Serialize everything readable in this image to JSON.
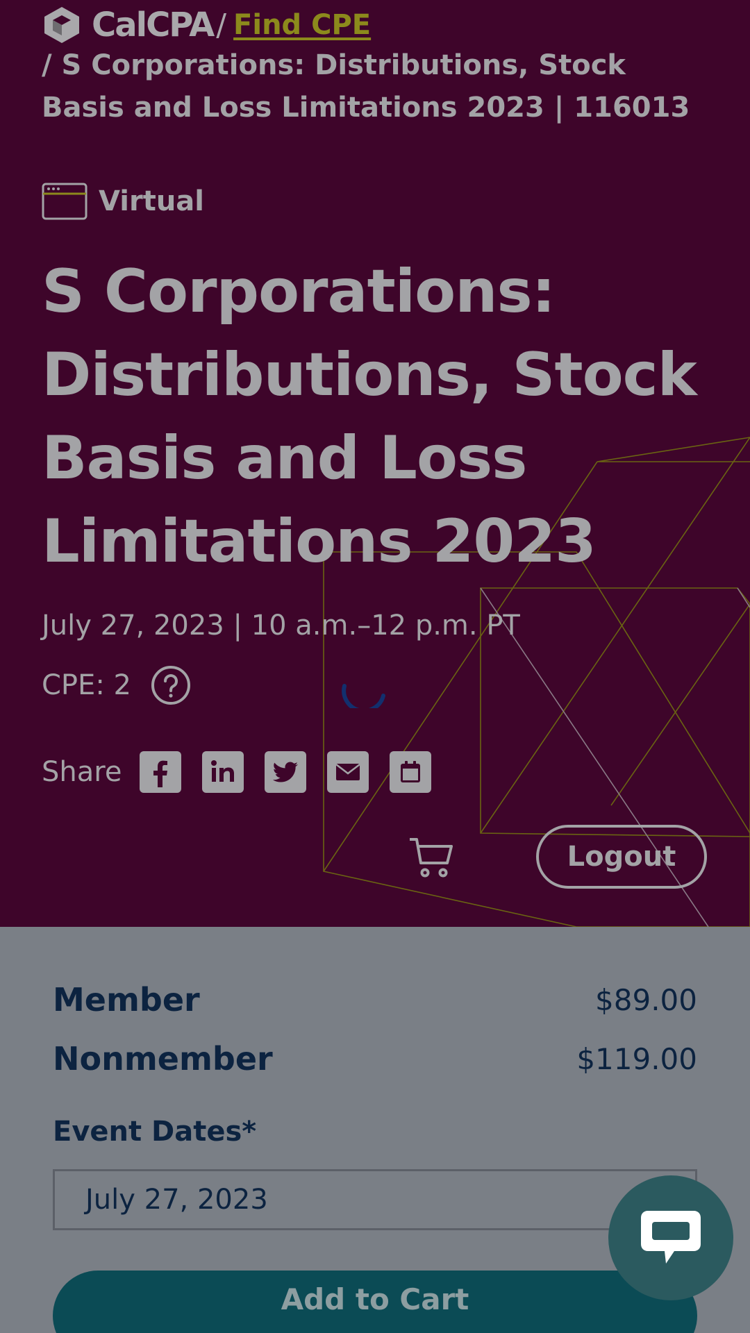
{
  "header": {
    "logo_text": "CalCPA",
    "separator": "/",
    "find_cpe_link": "Find CPE",
    "breadcrumb_tail": "/ S Corporations: Distributions, Stock Basis and Loss Limitations 2023 | 116013"
  },
  "event": {
    "format_icon": "browser-window-icon",
    "format": "Virtual",
    "title": "S Corporations: Distributions, Stock Basis and Loss Limitations 2023",
    "when": "July 27, 2023 | 10 a.m.–12 p.m. PT",
    "cpe": "CPE: 2"
  },
  "share": {
    "label": "Share",
    "buttons": [
      "facebook-icon",
      "linkedin-icon",
      "twitter-icon",
      "email-icon",
      "calendar-icon"
    ]
  },
  "nav": {
    "cart_icon": "cart-icon",
    "logout_label": "Logout"
  },
  "pricing": {
    "rows": [
      {
        "label": "Member",
        "price": "$89.00"
      },
      {
        "label": "Nonmember",
        "price": "$119.00"
      }
    ]
  },
  "registration": {
    "dates_label": "Event Dates*",
    "selected_date": "July 27, 2023",
    "add_to_cart_label": "Add to Cart"
  },
  "chat": {
    "icon": "chat-bubble-icon"
  },
  "colors": {
    "hero_background": "#3e052a",
    "accent_link": "#8c8a1c",
    "navy_text": "#0c2340",
    "teal_button": "#0b4b55"
  }
}
